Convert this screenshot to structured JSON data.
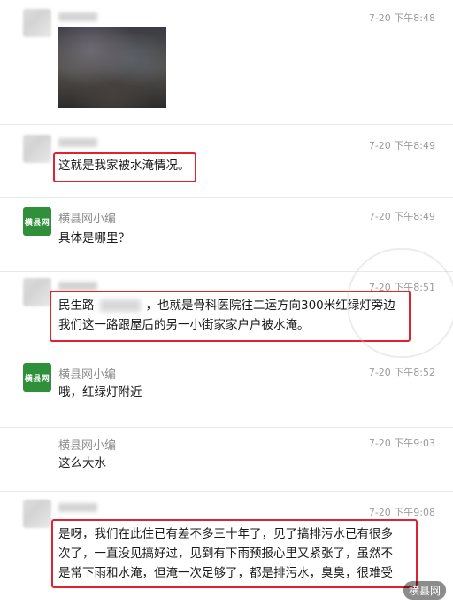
{
  "messages": [
    {
      "time": "7-20 下午8:48"
    },
    {
      "time": "7-20 下午8:49",
      "text": "这就是我家被水淹情况。"
    },
    {
      "sender": "横县网小编",
      "time": "7-20 下午8:49",
      "text": "具体是哪里？"
    },
    {
      "time": "7-20 下午8:51",
      "line1_a": "民生路",
      "line1_b": "，也就是骨科医院往二运方向300米红绿灯旁边",
      "line2": "我们这一路跟屋后的另一小街家家户户被水淹。"
    },
    {
      "sender": "横县网小编",
      "time": "7-20 下午8:52",
      "text": "哦，红绿灯附近"
    },
    {
      "sender": "横县网小编",
      "time": "7-20 下午9:03",
      "text": "这么大水"
    },
    {
      "time": "7-20 下午9:08",
      "lines": [
        "是呀，我们在此住已有差不多三十年了，见了搞排污水已有很多",
        "次了，一直没见搞好过，见到有下雨预报心里又紧张了，虽然不",
        "是常下雨和水淹，但淹一次足够了，都是排污水，臭臭，很难受"
      ]
    }
  ],
  "logo_text": "横县网",
  "watermark": "横县网",
  "colors": {
    "highlight": "#e0232f",
    "logo_green": "#2f8f3a"
  }
}
